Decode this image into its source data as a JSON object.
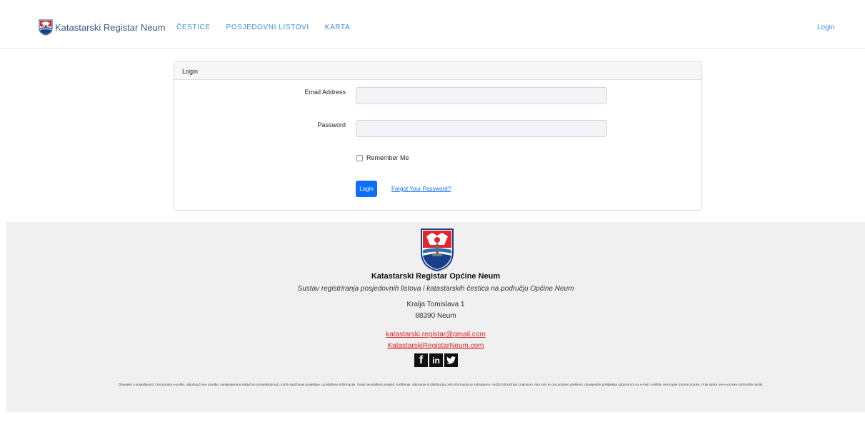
{
  "navbar": {
    "brand": "Katastarski Registar Neum",
    "links": [
      "ČESTICE",
      "POSJEDOVNI LISTOVI",
      "KARTA"
    ],
    "login": "Login"
  },
  "login_card": {
    "header": "Login",
    "email_label": "Email Address",
    "email_value": "",
    "password_label": "Password",
    "password_value": "",
    "remember_label": "Remember Me",
    "remember_checked": false,
    "login_button": "Login",
    "forgot_link": "Forgot Your Password?"
  },
  "footer": {
    "title": "Katastarski Registar Općine Neum",
    "subtitle": "Sustav registriranja posjedovnih listova i katastarskih čestica na području Općine Neum",
    "address_line1": "Kralja Tomislava 1",
    "address_line2": "88390 Neum",
    "email": "katastarski.registar@gmail.com",
    "website": "KatastarskiRegistarNeum.com",
    "social": [
      "facebook",
      "linkedin",
      "twitter"
    ],
    "notice": "Obavijest o povjerljivosti: Ova poruka e-pošte, uključujući sve privitke, namijenjena je isključivo primatelju(ima) i može sadržavati povjerljive i povlaštene informacije. Svaki neovlašteni pregled, korištenje, otkrivanje ili distribucija ovih informacija je zabranjeno i može biti kažnjivo zakonom. Ako vam je ova poslano greškom, obavijestite pošiljatelja odgovorom na e-mail i uništite sve kopije izvorne poruke. Prije ispisa ove e-poruke razmotrite okoliš."
  },
  "colors": {
    "nav_link": "#3d8fd6",
    "primary_button": "#0d6efd",
    "footer_link": "#d9262b",
    "footer_bg": "#f0f0f0"
  }
}
